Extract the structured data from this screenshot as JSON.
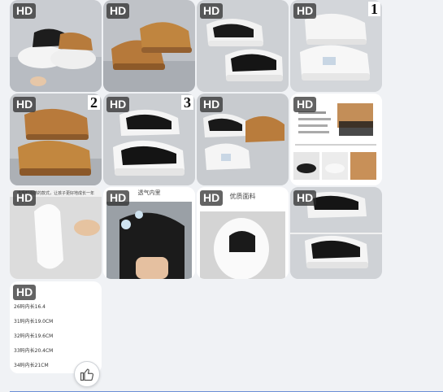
{
  "gallery": {
    "badge": "HD",
    "tiles": [
      {
        "badge": "HD",
        "number": ""
      },
      {
        "badge": "HD",
        "number": ""
      },
      {
        "badge": "HD",
        "number": ""
      },
      {
        "badge": "HD",
        "number": "1"
      },
      {
        "badge": "HD",
        "number": "2"
      },
      {
        "badge": "HD",
        "number": "3"
      },
      {
        "badge": "HD",
        "number": ""
      },
      {
        "badge": "HD",
        "number": ""
      },
      {
        "badge": "HD",
        "number": ""
      },
      {
        "badge": "HD",
        "number": ""
      },
      {
        "badge": "HD",
        "number": ""
      },
      {
        "badge": "HD",
        "number": ""
      },
      {
        "badge": "HD",
        "number": ""
      }
    ],
    "sheet_texts": {
      "tile10_caption": "透气内里",
      "tile11_caption": "优质面料",
      "tile9_caption": "选择时尚感的款式，让孩子更好地成长一年"
    },
    "size_lines": [
      "26码内长16.4",
      "31码内长19.0CM",
      "32码内长19.6CM",
      "33码内长20.4CM",
      "34码内长21CM"
    ]
  },
  "colors": {
    "background": "#f0f2f5",
    "badge_bg": "#282828",
    "accent_line": "#6b8fd6"
  },
  "icons": {
    "like": "thumbs-up-icon"
  }
}
